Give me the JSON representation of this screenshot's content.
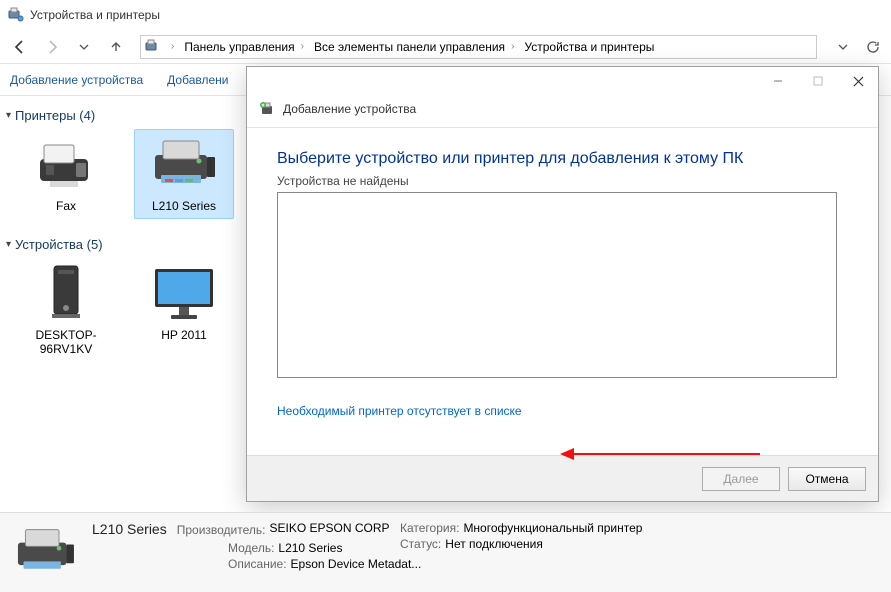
{
  "window_title": "Устройства и принтеры",
  "breadcrumb": {
    "items": [
      "Панель управления",
      "Все элементы панели управления",
      "Устройства и принтеры"
    ]
  },
  "toolbar": {
    "add_device": "Добавление устройства",
    "add_cut": "Добавлени"
  },
  "sections": {
    "printers": {
      "title": "Принтеры (4)"
    },
    "devices": {
      "title": "Устройства (5)"
    }
  },
  "printer_items": [
    {
      "label": "Fax"
    },
    {
      "label": "L210 Series"
    }
  ],
  "device_items": [
    {
      "label": "DESKTOP-96RV1KV"
    },
    {
      "label": "HP 2011"
    }
  ],
  "dialog": {
    "title": "Добавление устройства",
    "heading": "Выберите устройство или принтер для добавления к этому ПК",
    "subtext": "Устройства не найдены",
    "link": "Необходимый принтер отсутствует в списке",
    "next": "Далее",
    "cancel": "Отмена"
  },
  "details": {
    "name": "L210 Series",
    "labels": {
      "manufacturer": "Производитель:",
      "model": "Модель:",
      "description": "Описание:",
      "category": "Категория:",
      "status": "Статус:"
    },
    "values": {
      "manufacturer": "SEIKO EPSON CORP",
      "model": "L210 Series",
      "description": "Epson Device Metadat...",
      "category": "Многофункциональный принтер",
      "status": "Нет подключения"
    }
  }
}
